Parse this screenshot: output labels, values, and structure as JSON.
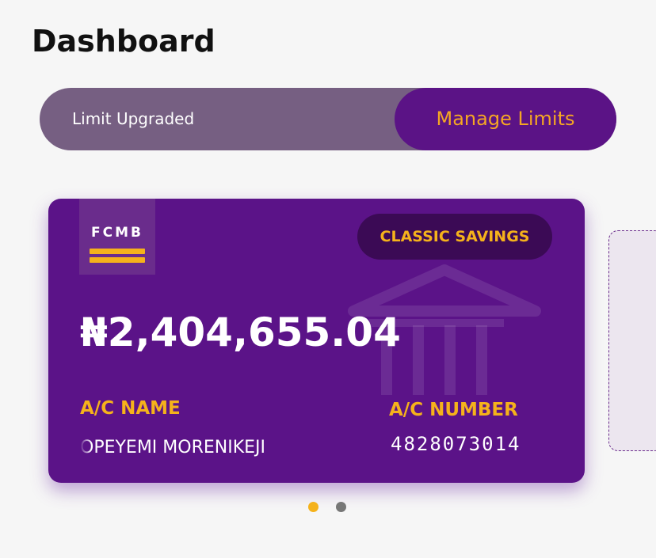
{
  "header": {
    "title": "Dashboard"
  },
  "limit_bar": {
    "status_text": "Limit Upgraded",
    "manage_label": "Manage Limits"
  },
  "card": {
    "bank_logo": "FCMB",
    "account_type": "CLASSIC SAVINGS",
    "balance": "₦2,404,655.04",
    "ac_name_label": "A/C NAME",
    "ac_name_value": "OPEYEMI MORENIKEJI",
    "ac_number_label": "A/C NUMBER",
    "ac_number_value": "4828073014",
    "watermark_icon": "bank-building-icon"
  },
  "pagination": {
    "total": 2,
    "active_index": 0
  },
  "colors": {
    "brand_purple": "#5b1388",
    "accent_gold": "#f5b21b",
    "limit_bar_bg": "#765f82",
    "badge_bg": "#3b0a55"
  }
}
